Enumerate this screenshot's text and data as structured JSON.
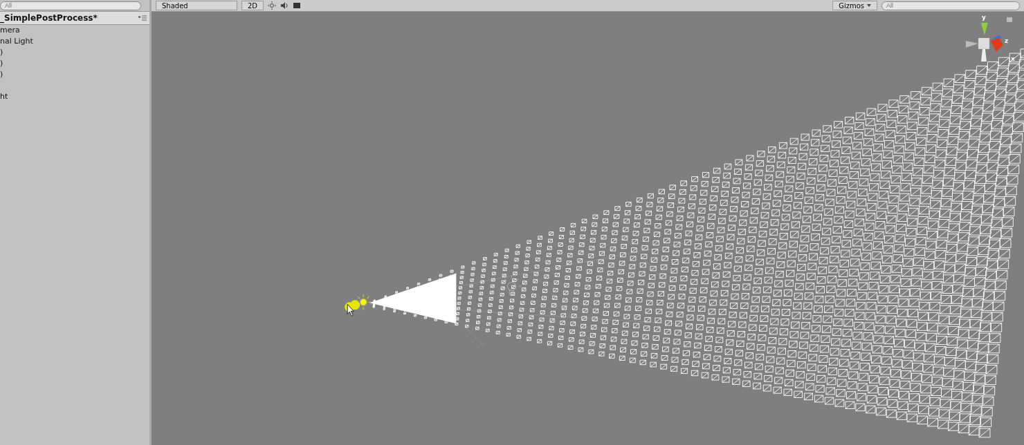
{
  "hierarchy": {
    "search": {
      "placeholder": "All"
    },
    "scene_title": "_SimplePostProcess*",
    "groups": [
      [
        "mera",
        "nal Light",
        ")",
        ")",
        ")"
      ],
      [
        "ht"
      ]
    ]
  },
  "scene_toolbar": {
    "draw_mode": "Shaded",
    "mode_2d": "2D",
    "gizmos": "Gizmos",
    "search": {
      "placeholder": "All"
    }
  },
  "axis_gizmo": {
    "labels": [
      "y",
      "z",
      "x"
    ]
  }
}
